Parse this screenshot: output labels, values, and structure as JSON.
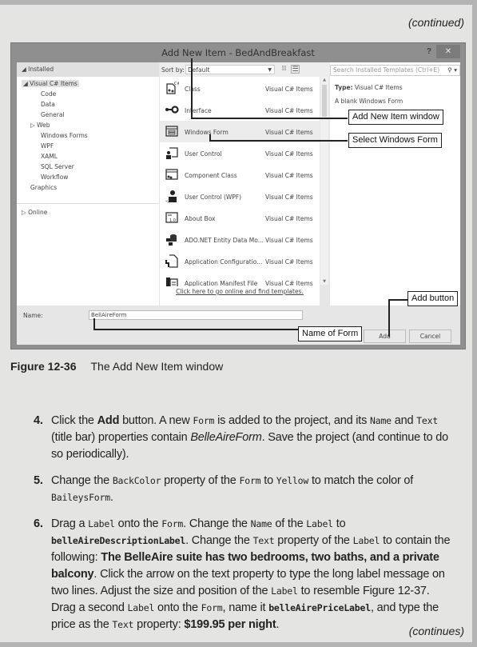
{
  "header": {
    "continued": "(continued)",
    "continues": "(continues)"
  },
  "dialog": {
    "title": "Add New Item - BedAndBreakfast",
    "help": "?",
    "close": "✕",
    "installed_header": "Installed",
    "tree": [
      {
        "label": "Visual C# Items",
        "expander": "◢",
        "selected": true
      },
      {
        "label": "Code"
      },
      {
        "label": "Data"
      },
      {
        "label": "General"
      },
      {
        "label": "Web",
        "expander": "▷"
      },
      {
        "label": "Windows Forms"
      },
      {
        "label": "WPF"
      },
      {
        "label": "XAML"
      },
      {
        "label": "SQL Server"
      },
      {
        "label": "Workflow"
      },
      {
        "label": "Graphics"
      }
    ],
    "online": "Online",
    "sort_by_label": "Sort by:",
    "sort_by_value": "Default",
    "templates": [
      {
        "name": "Class",
        "category": "Visual C# Items",
        "icon": "class-icon"
      },
      {
        "name": "Interface",
        "category": "Visual C# Items",
        "icon": "interface-icon"
      },
      {
        "name": "Windows Form",
        "category": "Visual C# Items",
        "icon": "windows-form-icon",
        "selected": true
      },
      {
        "name": "User Control",
        "category": "Visual C# Items",
        "icon": "user-control-icon"
      },
      {
        "name": "Component Class",
        "category": "Visual C# Items",
        "icon": "component-class-icon"
      },
      {
        "name": "User Control (WPF)",
        "category": "Visual C# Items",
        "icon": "user-control-wpf-icon"
      },
      {
        "name": "About Box",
        "category": "Visual C# Items",
        "icon": "about-box-icon"
      },
      {
        "name": "ADO.NET Entity Data Mo...",
        "category": "Visual C# Items",
        "icon": "entity-data-model-icon"
      },
      {
        "name": "Application Configuratio...",
        "category": "Visual C# Items",
        "icon": "app-config-icon"
      },
      {
        "name": "Application Manifest File",
        "category": "Visual C# Items",
        "icon": "app-manifest-icon"
      }
    ],
    "online_link": "Click here to go online and find templates.",
    "search_placeholder": "Search Installed Templates (Ctrl+E)",
    "type_label": "Type:",
    "type_value": "Visual C# Items",
    "description": "A blank Windows Form",
    "name_label": "Name:",
    "name_value": "BellAireForm",
    "add_button": "Add",
    "cancel_button": "Cancel"
  },
  "callouts": {
    "add_new_item_window": "Add New Item window",
    "select_windows_form": "Select Windows Form",
    "add_button": "Add button",
    "name_of_form": "Name of Form"
  },
  "caption": {
    "figure": "Figure 12-36",
    "text": "The Add New Item window"
  },
  "steps": [
    {
      "num": "4.",
      "parts": [
        {
          "t": "Click the "
        },
        {
          "t": "Add",
          "s": "b"
        },
        {
          "t": " button. A new "
        },
        {
          "t": "Form",
          "s": "code"
        },
        {
          "t": " is added to the project, and its "
        },
        {
          "t": "Name",
          "s": "code"
        },
        {
          "t": " and "
        },
        {
          "t": "Text",
          "s": "code"
        },
        {
          "t": " (title bar) properties contain "
        },
        {
          "t": "BelleAireForm",
          "s": "i"
        },
        {
          "t": ". Save the project (and continue to do so periodically)."
        }
      ]
    },
    {
      "num": "5.",
      "parts": [
        {
          "t": "Change the "
        },
        {
          "t": "BackColor",
          "s": "code"
        },
        {
          "t": " property of the "
        },
        {
          "t": "Form",
          "s": "code"
        },
        {
          "t": " to "
        },
        {
          "t": "Yellow",
          "s": "code"
        },
        {
          "t": " to match the color of "
        },
        {
          "t": "BaileysForm",
          "s": "code"
        },
        {
          "t": "."
        }
      ]
    },
    {
      "num": "6.",
      "parts": [
        {
          "t": "Drag a "
        },
        {
          "t": "Label",
          "s": "code"
        },
        {
          "t": " onto the "
        },
        {
          "t": "Form",
          "s": "code"
        },
        {
          "t": ". Change the "
        },
        {
          "t": "Name",
          "s": "code"
        },
        {
          "t": " of the "
        },
        {
          "t": "Label",
          "s": "code"
        },
        {
          "t": " to "
        },
        {
          "t": "belleAireDescriptionLabel",
          "s": "code b"
        },
        {
          "t": ". Change the "
        },
        {
          "t": "Text",
          "s": "code"
        },
        {
          "t": " property of the "
        },
        {
          "t": "Label",
          "s": "code"
        },
        {
          "t": " to contain the following: "
        },
        {
          "t": "The BelleAire suite has two bedrooms, two baths, and a private balcony",
          "s": "b"
        },
        {
          "t": ". Click the arrow on the text property to type the long label message on two lines. Adjust the size and position of the "
        },
        {
          "t": "Label",
          "s": "code"
        },
        {
          "t": " to resemble Figure 12-37. Drag a second "
        },
        {
          "t": "Label",
          "s": "code"
        },
        {
          "t": " onto the "
        },
        {
          "t": "Form",
          "s": "code"
        },
        {
          "t": ", name it "
        },
        {
          "t": "belleAirePriceLabel",
          "s": "code b"
        },
        {
          "t": ", and type the price as the "
        },
        {
          "t": "Text",
          "s": "code"
        },
        {
          "t": " property: "
        },
        {
          "t": "$199.95 per night",
          "s": "b"
        },
        {
          "t": "."
        }
      ]
    }
  ]
}
